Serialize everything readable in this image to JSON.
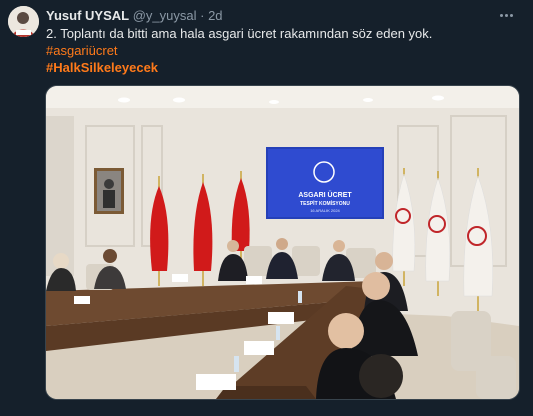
{
  "tweet": {
    "author_name": "Yusuf UYSAL",
    "author_handle": "@y_yuysal",
    "separator": "·",
    "timestamp": "2d",
    "text_line": "2. Toplantı da bitti ama hala asgari ücret rakamından söz eden yok.",
    "hashtags": [
      "#asgariücret",
      "#HalkSilkeleyecek"
    ]
  },
  "screen": {
    "title": "ASGARI ÜCRET",
    "subtitle": "TESPİT KOMİSYONU",
    "date": "16 ARALIK 2024"
  },
  "icons": {
    "avatar": "avatar-image",
    "more": "more-horizontal-icon"
  }
}
